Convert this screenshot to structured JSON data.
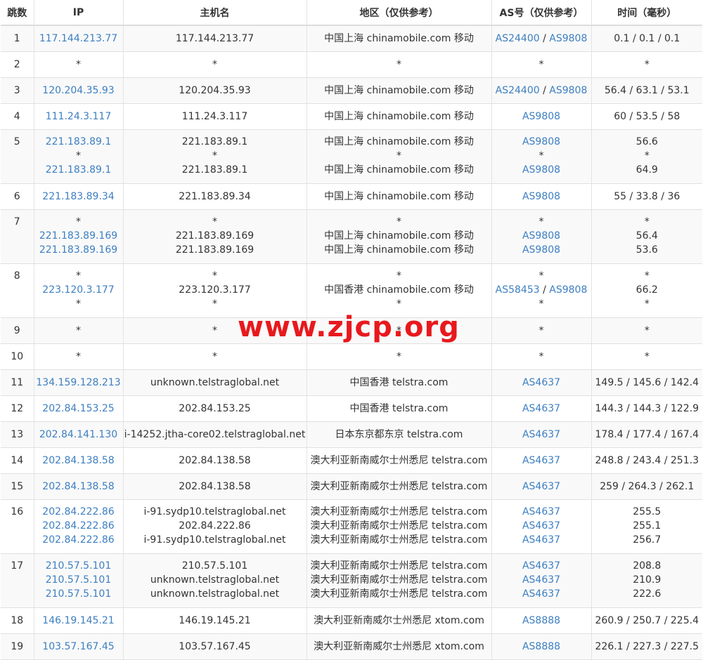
{
  "headers": [
    "跳数",
    "IP",
    "主机名",
    "地区（仅供参考）",
    "AS号（仅供参考）",
    "时间（毫秒）"
  ],
  "watermark": "www.zjcp.org",
  "rows": [
    {
      "hop": "1",
      "ips": [
        "117.144.213.77"
      ],
      "hosts": [
        "117.144.213.77"
      ],
      "regions": [
        "中国上海 chinamobile.com 移动"
      ],
      "asns": [
        [
          "AS24400",
          "AS9808"
        ]
      ],
      "times": [
        "0.1 / 0.1 / 0.1"
      ]
    },
    {
      "hop": "2",
      "ips": [
        "*"
      ],
      "hosts": [
        "*"
      ],
      "regions": [
        "*"
      ],
      "asns": [
        [
          "*"
        ]
      ],
      "times": [
        "*"
      ]
    },
    {
      "hop": "3",
      "ips": [
        "120.204.35.93"
      ],
      "hosts": [
        "120.204.35.93"
      ],
      "regions": [
        "中国上海 chinamobile.com 移动"
      ],
      "asns": [
        [
          "AS24400",
          "AS9808"
        ]
      ],
      "times": [
        "56.4 / 63.1 / 53.1"
      ]
    },
    {
      "hop": "4",
      "ips": [
        "111.24.3.117"
      ],
      "hosts": [
        "111.24.3.117"
      ],
      "regions": [
        "中国上海 chinamobile.com 移动"
      ],
      "asns": [
        [
          "AS9808"
        ]
      ],
      "times": [
        "60 / 53.5 / 58"
      ]
    },
    {
      "hop": "5",
      "ips": [
        "221.183.89.1",
        "*",
        "221.183.89.1"
      ],
      "hosts": [
        "221.183.89.1",
        "*",
        "221.183.89.1"
      ],
      "regions": [
        "中国上海 chinamobile.com 移动",
        "*",
        "中国上海 chinamobile.com 移动"
      ],
      "asns": [
        [
          "AS9808"
        ],
        [
          "*"
        ],
        [
          "AS9808"
        ]
      ],
      "times": [
        "56.6",
        "*",
        "64.9"
      ]
    },
    {
      "hop": "6",
      "ips": [
        "221.183.89.34"
      ],
      "hosts": [
        "221.183.89.34"
      ],
      "regions": [
        "中国上海 chinamobile.com 移动"
      ],
      "asns": [
        [
          "AS9808"
        ]
      ],
      "times": [
        "55 / 33.8 / 36"
      ]
    },
    {
      "hop": "7",
      "ips": [
        "*",
        "221.183.89.169",
        "221.183.89.169"
      ],
      "hosts": [
        "*",
        "221.183.89.169",
        "221.183.89.169"
      ],
      "regions": [
        "*",
        "中国上海 chinamobile.com 移动",
        "中国上海 chinamobile.com 移动"
      ],
      "asns": [
        [
          "*"
        ],
        [
          "AS9808"
        ],
        [
          "AS9808"
        ]
      ],
      "times": [
        "*",
        "56.4",
        "53.6"
      ]
    },
    {
      "hop": "8",
      "ips": [
        "*",
        "223.120.3.177",
        "*"
      ],
      "hosts": [
        "*",
        "223.120.3.177",
        "*"
      ],
      "regions": [
        "*",
        "中国香港 chinamobile.com 移动",
        "*"
      ],
      "asns": [
        [
          "*"
        ],
        [
          "AS58453",
          "AS9808"
        ],
        [
          "*"
        ]
      ],
      "times": [
        "*",
        "66.2",
        "*"
      ]
    },
    {
      "hop": "9",
      "ips": [
        "*"
      ],
      "hosts": [
        "*"
      ],
      "regions": [
        "*"
      ],
      "asns": [
        [
          "*"
        ]
      ],
      "times": [
        "*"
      ]
    },
    {
      "hop": "10",
      "ips": [
        "*"
      ],
      "hosts": [
        "*"
      ],
      "regions": [
        "*"
      ],
      "asns": [
        [
          "*"
        ]
      ],
      "times": [
        "*"
      ]
    },
    {
      "hop": "11",
      "ips": [
        "134.159.128.213"
      ],
      "hosts": [
        "unknown.telstraglobal.net"
      ],
      "regions": [
        "中国香港 telstra.com"
      ],
      "asns": [
        [
          "AS4637"
        ]
      ],
      "times": [
        "149.5 / 145.6 / 142.4"
      ]
    },
    {
      "hop": "12",
      "ips": [
        "202.84.153.25"
      ],
      "hosts": [
        "202.84.153.25"
      ],
      "regions": [
        "中国香港 telstra.com"
      ],
      "asns": [
        [
          "AS4637"
        ]
      ],
      "times": [
        "144.3 / 144.3 / 122.9"
      ]
    },
    {
      "hop": "13",
      "ips": [
        "202.84.141.130"
      ],
      "hosts": [
        "i-14252.jtha-core02.telstraglobal.net"
      ],
      "regions": [
        "日本东京都东京 telstra.com"
      ],
      "asns": [
        [
          "AS4637"
        ]
      ],
      "times": [
        "178.4 / 177.4 / 167.4"
      ]
    },
    {
      "hop": "14",
      "ips": [
        "202.84.138.58"
      ],
      "hosts": [
        "202.84.138.58"
      ],
      "regions": [
        "澳大利亚新南威尔士州悉尼 telstra.com"
      ],
      "asns": [
        [
          "AS4637"
        ]
      ],
      "times": [
        "248.8 / 243.4 / 251.3"
      ]
    },
    {
      "hop": "15",
      "ips": [
        "202.84.138.58"
      ],
      "hosts": [
        "202.84.138.58"
      ],
      "regions": [
        "澳大利亚新南威尔士州悉尼 telstra.com"
      ],
      "asns": [
        [
          "AS4637"
        ]
      ],
      "times": [
        "259 / 264.3 / 262.1"
      ]
    },
    {
      "hop": "16",
      "ips": [
        "202.84.222.86",
        "202.84.222.86",
        "202.84.222.86"
      ],
      "hosts": [
        "i-91.sydp10.telstraglobal.net",
        "202.84.222.86",
        "i-91.sydp10.telstraglobal.net"
      ],
      "regions": [
        "澳大利亚新南威尔士州悉尼 telstra.com",
        "澳大利亚新南威尔士州悉尼 telstra.com",
        "澳大利亚新南威尔士州悉尼 telstra.com"
      ],
      "asns": [
        [
          "AS4637"
        ],
        [
          "AS4637"
        ],
        [
          "AS4637"
        ]
      ],
      "times": [
        "255.5",
        "255.1",
        "256.7"
      ]
    },
    {
      "hop": "17",
      "ips": [
        "210.57.5.101",
        "210.57.5.101",
        "210.57.5.101"
      ],
      "hosts": [
        "210.57.5.101",
        "unknown.telstraglobal.net",
        "unknown.telstraglobal.net"
      ],
      "regions": [
        "澳大利亚新南威尔士州悉尼 telstra.com",
        "澳大利亚新南威尔士州悉尼 telstra.com",
        "澳大利亚新南威尔士州悉尼 telstra.com"
      ],
      "asns": [
        [
          "AS4637"
        ],
        [
          "AS4637"
        ],
        [
          "AS4637"
        ]
      ],
      "times": [
        "208.8",
        "210.9",
        "222.6"
      ]
    },
    {
      "hop": "18",
      "ips": [
        "146.19.145.21"
      ],
      "hosts": [
        "146.19.145.21"
      ],
      "regions": [
        "澳大利亚新南威尔士州悉尼 xtom.com"
      ],
      "asns": [
        [
          "AS8888"
        ]
      ],
      "times": [
        "260.9 / 250.7 / 225.4"
      ]
    },
    {
      "hop": "19",
      "ips": [
        "103.57.167.45"
      ],
      "hosts": [
        "103.57.167.45"
      ],
      "regions": [
        "澳大利亚新南威尔士州悉尼 xtom.com"
      ],
      "asns": [
        [
          "AS8888"
        ]
      ],
      "times": [
        "226.1 / 227.3 / 227.5"
      ]
    }
  ]
}
